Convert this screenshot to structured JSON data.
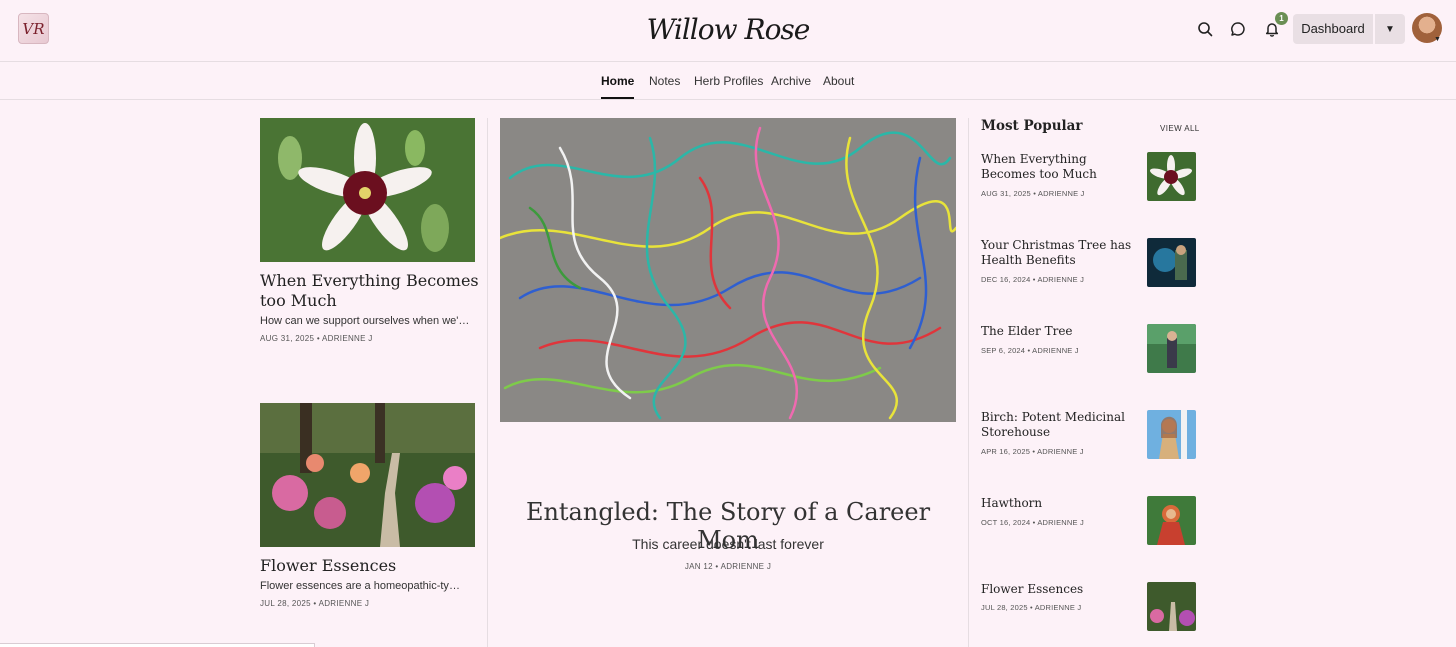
{
  "header": {
    "brand": "Willow Rose",
    "logo_text": "VR",
    "notification_count": "1",
    "dashboard_label": "Dashboard"
  },
  "nav": {
    "items": [
      {
        "label": "Home",
        "active": true
      },
      {
        "label": "Notes"
      },
      {
        "label": "Herb Profiles"
      },
      {
        "label": "Archive"
      },
      {
        "label": "About"
      }
    ]
  },
  "left_posts": [
    {
      "title": "When Everything Becomes too Much",
      "excerpt": "How can we support ourselves when we're ...",
      "meta": "AUG 31, 2025 • ADRIENNE J"
    },
    {
      "title": "Flower Essences",
      "excerpt": "Flower essences are a homeopathic-type...",
      "meta": "JUL 28, 2025 • ADRIENNE J"
    }
  ],
  "feature": {
    "title": "Entangled: The Story of a Career Mom",
    "subtitle": "This career doesn't last forever",
    "meta": "JAN 12 • ADRIENNE J"
  },
  "popular": {
    "heading": "Most Popular",
    "view_all": "VIEW ALL",
    "items": [
      {
        "title": "When Everything Becomes too Much",
        "meta": "AUG 31, 2025 • ADRIENNE J"
      },
      {
        "title": "Your Christmas Tree has Health Benefits",
        "meta": "DEC 16, 2024 • ADRIENNE J"
      },
      {
        "title": "The Elder Tree",
        "meta": "SEP 6, 2024 • ADRIENNE J"
      },
      {
        "title": "Birch: Potent Medicinal Storehouse",
        "meta": "APR 16, 2025 • ADRIENNE J"
      },
      {
        "title": "Hawthorn",
        "meta": "OCT 16, 2024 • ADRIENNE J"
      },
      {
        "title": "Flower Essences",
        "meta": "JUL 28, 2025 • ADRIENNE J"
      }
    ]
  },
  "colors": {
    "background": "#fdf2f8",
    "badge": "#6a8f54",
    "button": "#e9dfe4"
  }
}
